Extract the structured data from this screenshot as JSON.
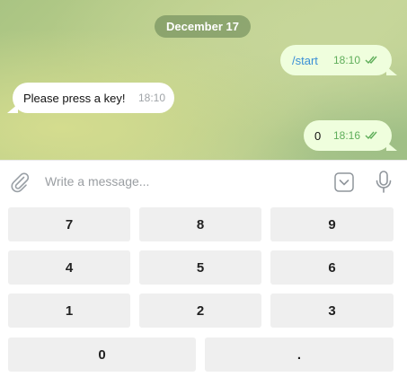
{
  "chat": {
    "date_label": "December 17",
    "messages": [
      {
        "text": "/start",
        "time": "18:10",
        "direction": "outgoing",
        "status": "read"
      },
      {
        "text": "Please press a key!",
        "time": "18:10",
        "direction": "incoming"
      },
      {
        "text": "0",
        "time": "18:16",
        "direction": "outgoing",
        "status": "read"
      }
    ]
  },
  "composer": {
    "placeholder": "Write a message...",
    "attach_icon": "paperclip-icon",
    "keyboard_icon": "chevron-down-icon",
    "mic_icon": "microphone-icon"
  },
  "keyboard": {
    "rows": [
      [
        "7",
        "8",
        "9"
      ],
      [
        "4",
        "5",
        "6"
      ],
      [
        "1",
        "2",
        "3"
      ],
      [
        "0",
        "."
      ]
    ]
  },
  "colors": {
    "outgoing_bubble": "#effedd",
    "incoming_bubble": "#ffffff",
    "read_check": "#5fae5a",
    "key_background": "#efefef",
    "command_link": "#3a8fd6"
  }
}
